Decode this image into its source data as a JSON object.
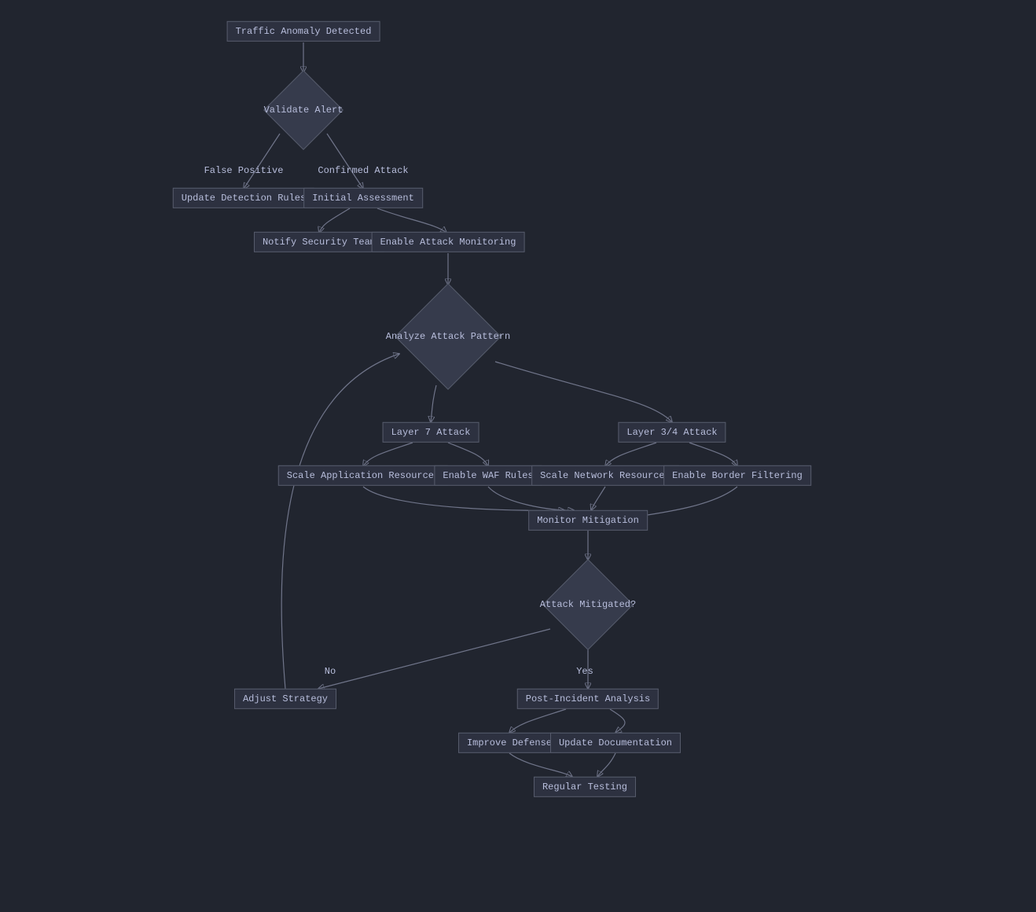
{
  "nodes": {
    "traffic_anomaly": "Traffic Anomaly Detected",
    "validate_alert": "Validate Alert",
    "update_rules": "Update Detection Rules",
    "initial_assessment": "Initial Assessment",
    "notify_team": "Notify Security Team",
    "enable_monitoring": "Enable Attack Monitoring",
    "analyze_pattern": "Analyze Attack Pattern",
    "layer7": "Layer 7 Attack",
    "layer34": "Layer 3/4 Attack",
    "scale_app": "Scale Application Resources",
    "enable_waf": "Enable WAF Rules",
    "scale_net": "Scale Network Resources",
    "enable_border": "Enable Border Filtering",
    "monitor_mitigation": "Monitor Mitigation",
    "attack_mitigated": "Attack Mitigated?",
    "adjust_strategy": "Adjust Strategy",
    "post_incident": "Post-Incident Analysis",
    "improve_defense": "Improve Defense",
    "update_doc": "Update Documentation",
    "regular_testing": "Regular Testing"
  },
  "edge_labels": {
    "false_positive": "False Positive",
    "confirmed_attack": "Confirmed Attack",
    "yes": "Yes",
    "no": "No"
  },
  "chart_data": {
    "type": "flowchart",
    "nodes": [
      {
        "id": "traffic_anomaly",
        "label": "Traffic Anomaly Detected",
        "shape": "rect"
      },
      {
        "id": "validate_alert",
        "label": "Validate Alert",
        "shape": "diamond"
      },
      {
        "id": "update_rules",
        "label": "Update Detection Rules",
        "shape": "rect"
      },
      {
        "id": "initial_assessment",
        "label": "Initial Assessment",
        "shape": "rect"
      },
      {
        "id": "notify_team",
        "label": "Notify Security Team",
        "shape": "rect"
      },
      {
        "id": "enable_monitoring",
        "label": "Enable Attack Monitoring",
        "shape": "rect"
      },
      {
        "id": "analyze_pattern",
        "label": "Analyze Attack Pattern",
        "shape": "diamond"
      },
      {
        "id": "layer7",
        "label": "Layer 7 Attack",
        "shape": "rect"
      },
      {
        "id": "layer34",
        "label": "Layer 3/4 Attack",
        "shape": "rect"
      },
      {
        "id": "scale_app",
        "label": "Scale Application Resources",
        "shape": "rect"
      },
      {
        "id": "enable_waf",
        "label": "Enable WAF Rules",
        "shape": "rect"
      },
      {
        "id": "scale_net",
        "label": "Scale Network Resources",
        "shape": "rect"
      },
      {
        "id": "enable_border",
        "label": "Enable Border Filtering",
        "shape": "rect"
      },
      {
        "id": "monitor_mitigation",
        "label": "Monitor Mitigation",
        "shape": "rect"
      },
      {
        "id": "attack_mitigated",
        "label": "Attack Mitigated?",
        "shape": "diamond"
      },
      {
        "id": "adjust_strategy",
        "label": "Adjust Strategy",
        "shape": "rect"
      },
      {
        "id": "post_incident",
        "label": "Post-Incident Analysis",
        "shape": "rect"
      },
      {
        "id": "improve_defense",
        "label": "Improve Defense",
        "shape": "rect"
      },
      {
        "id": "update_doc",
        "label": "Update Documentation",
        "shape": "rect"
      },
      {
        "id": "regular_testing",
        "label": "Regular Testing",
        "shape": "rect"
      }
    ],
    "edges": [
      {
        "from": "traffic_anomaly",
        "to": "validate_alert"
      },
      {
        "from": "validate_alert",
        "to": "update_rules",
        "label": "False Positive"
      },
      {
        "from": "validate_alert",
        "to": "initial_assessment",
        "label": "Confirmed Attack"
      },
      {
        "from": "initial_assessment",
        "to": "notify_team"
      },
      {
        "from": "initial_assessment",
        "to": "enable_monitoring"
      },
      {
        "from": "enable_monitoring",
        "to": "analyze_pattern"
      },
      {
        "from": "analyze_pattern",
        "to": "layer7"
      },
      {
        "from": "analyze_pattern",
        "to": "layer34"
      },
      {
        "from": "layer7",
        "to": "scale_app"
      },
      {
        "from": "layer7",
        "to": "enable_waf"
      },
      {
        "from": "layer34",
        "to": "scale_net"
      },
      {
        "from": "layer34",
        "to": "enable_border"
      },
      {
        "from": "scale_app",
        "to": "monitor_mitigation"
      },
      {
        "from": "enable_waf",
        "to": "monitor_mitigation"
      },
      {
        "from": "scale_net",
        "to": "monitor_mitigation"
      },
      {
        "from": "enable_border",
        "to": "monitor_mitigation"
      },
      {
        "from": "monitor_mitigation",
        "to": "attack_mitigated"
      },
      {
        "from": "attack_mitigated",
        "to": "adjust_strategy",
        "label": "No"
      },
      {
        "from": "attack_mitigated",
        "to": "post_incident",
        "label": "Yes"
      },
      {
        "from": "adjust_strategy",
        "to": "analyze_pattern"
      },
      {
        "from": "post_incident",
        "to": "improve_defense"
      },
      {
        "from": "post_incident",
        "to": "update_doc"
      },
      {
        "from": "improve_defense",
        "to": "regular_testing"
      },
      {
        "from": "update_doc",
        "to": "regular_testing"
      }
    ]
  }
}
